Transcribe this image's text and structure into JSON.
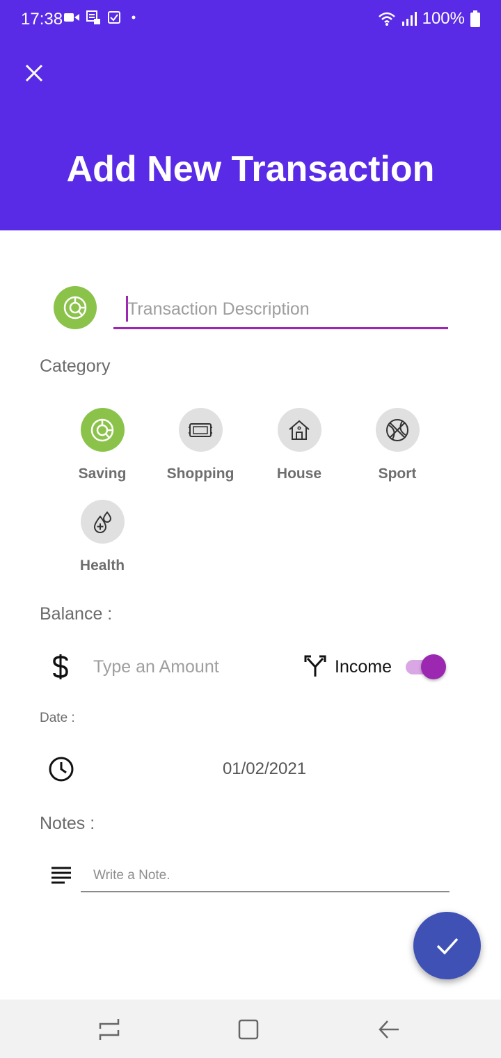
{
  "status_bar": {
    "time": "17:38",
    "battery": "100%",
    "icons": [
      "video-camera-icon",
      "sim-card-icon",
      "checkbox-icon",
      "dot-icon",
      "wifi-icon",
      "signal-icon",
      "battery-icon"
    ]
  },
  "header": {
    "title": "Add New Transaction",
    "background_color": "#5a2be6",
    "close_icon": "close-icon"
  },
  "description": {
    "placeholder": "Transaction Description",
    "value": "",
    "selected_icon": "saving-chart-icon",
    "accent_color": "#9c27b0"
  },
  "category": {
    "label": "Category",
    "selected": "Saving",
    "items": [
      {
        "label": "Saving",
        "icon": "pie-chart-icon",
        "selected": true
      },
      {
        "label": "Shopping",
        "icon": "ticket-icon",
        "selected": false
      },
      {
        "label": "House",
        "icon": "house-icon",
        "selected": false
      },
      {
        "label": "Sport",
        "icon": "basketball-icon",
        "selected": false
      },
      {
        "label": "Health",
        "icon": "health-drop-icon",
        "selected": false
      }
    ],
    "selected_color": "#8bc34a"
  },
  "balance": {
    "label": "Balance :",
    "amount_placeholder": "Type an Amount",
    "amount_value": "",
    "type_label": "Income",
    "income_enabled": true
  },
  "date": {
    "label": "Date :",
    "value": "01/02/2021"
  },
  "notes": {
    "label": "Notes :",
    "placeholder": "Write a Note.",
    "value": ""
  },
  "fab": {
    "icon": "check-icon",
    "color": "#3f51b5"
  },
  "nav_bar": {
    "items": [
      "recent-apps-icon",
      "home-icon",
      "back-icon"
    ]
  }
}
